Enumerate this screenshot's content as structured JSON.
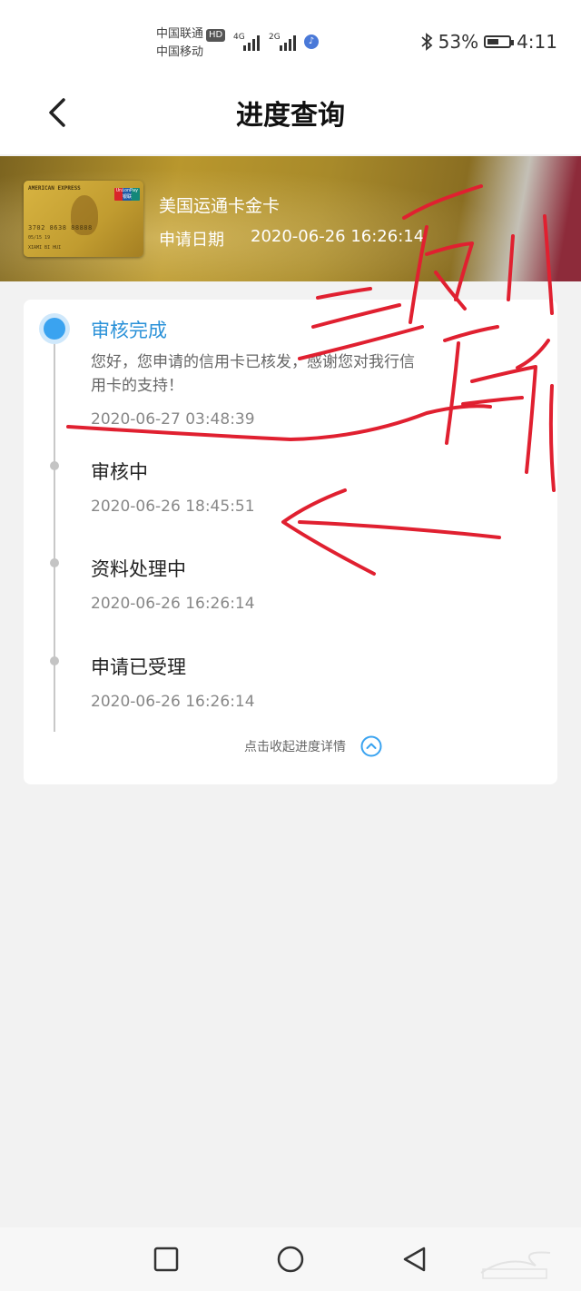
{
  "status_bar": {
    "carrier_1": "中国联通",
    "carrier_1_badge": "HD",
    "carrier_2": "中国移动",
    "network_1": "4G",
    "network_2": "2G",
    "battery": "53%",
    "battery_level": 0.53,
    "time": "4:11"
  },
  "header": {
    "title": "进度查询",
    "back_icon": "chevron-left-icon"
  },
  "card": {
    "name": "美国运通卡金卡",
    "apply_date_label": "申请日期",
    "apply_date": "2020-06-26 16:26:14",
    "image": {
      "brand": "AMERICAN EXPRESS",
      "network": "UnionPay 银联",
      "number": "3702 8638 88888",
      "expiry": "05/15   19",
      "holder": "XIAMI BI HUI"
    }
  },
  "progress": {
    "steps": [
      {
        "title": "审核完成",
        "description": "您好，您申请的信用卡已核发，感谢您对我行信用卡的支持！",
        "time": "2020-06-27 03:48:39",
        "active": true
      },
      {
        "title": "审核中",
        "time": "2020-06-26 18:45:51",
        "active": false
      },
      {
        "title": "资料处理中",
        "time": "2020-06-26 16:26:14",
        "active": false
      },
      {
        "title": "申请已受理",
        "time": "2020-06-26 16:26:14",
        "active": false
      }
    ],
    "collapse_label": "点击收起进度详情",
    "collapse_icon": "chevron-up-circle-icon"
  },
  "colors": {
    "accent": "#2a91d8",
    "scribble": "#e02030"
  },
  "system_nav": {
    "buttons": [
      "recent-apps",
      "home",
      "back"
    ]
  }
}
